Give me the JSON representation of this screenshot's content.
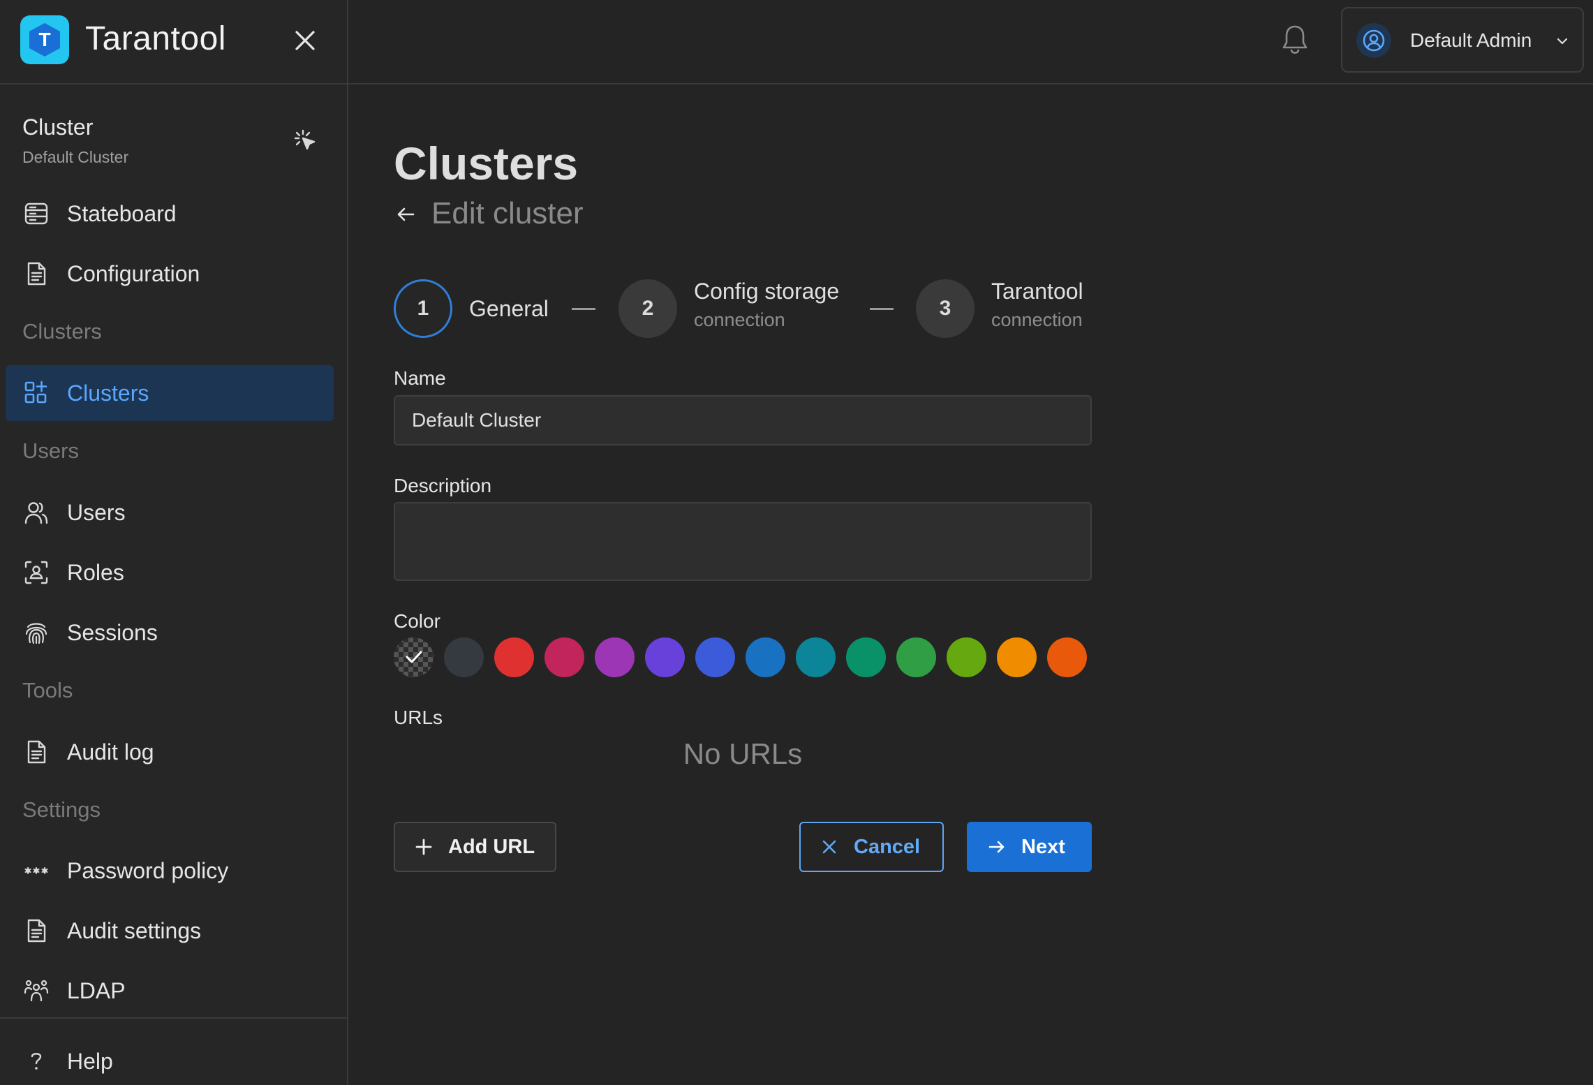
{
  "brand": {
    "name": "Tarantool",
    "logo_letter": "T"
  },
  "cluster_selector": {
    "title": "Cluster",
    "value": "Default Cluster"
  },
  "sidebar": {
    "items": [
      {
        "label": "Stateboard"
      },
      {
        "label": "Configuration"
      },
      {
        "section": "Clusters"
      },
      {
        "label": "Clusters",
        "active": true
      },
      {
        "section": "Users"
      },
      {
        "label": "Users"
      },
      {
        "label": "Roles"
      },
      {
        "label": "Sessions"
      },
      {
        "section": "Tools"
      },
      {
        "label": "Audit log"
      },
      {
        "section": "Settings"
      },
      {
        "label": "Password policy"
      },
      {
        "label": "Audit settings"
      },
      {
        "label": "LDAP"
      },
      {
        "label": "Help"
      }
    ]
  },
  "header": {
    "user_name": "Default Admin"
  },
  "page": {
    "title": "Clusters",
    "subtitle": "Edit cluster"
  },
  "steps": [
    {
      "number": "1",
      "title": "General",
      "subtitle": ""
    },
    {
      "number": "2",
      "title": "Config storage",
      "subtitle": "connection"
    },
    {
      "number": "3",
      "title": "Tarantool",
      "subtitle": "connection"
    }
  ],
  "form": {
    "name_label": "Name",
    "name_value": "Default Cluster",
    "description_label": "Description",
    "description_value": "",
    "color_label": "Color",
    "colors": [
      "transparent",
      "#343a40",
      "#e03131",
      "#c2255c",
      "#9c36b5",
      "#6741d9",
      "#3b5bdb",
      "#1971c2",
      "#0c8599",
      "#099268",
      "#2f9e44",
      "#66a80f",
      "#f08c00",
      "#e8590c"
    ],
    "selected_color": "transparent",
    "urls_label": "URLs",
    "no_urls": "No URLs"
  },
  "buttons": {
    "add_url": "Add URL",
    "cancel": "Cancel",
    "next": "Next"
  }
}
